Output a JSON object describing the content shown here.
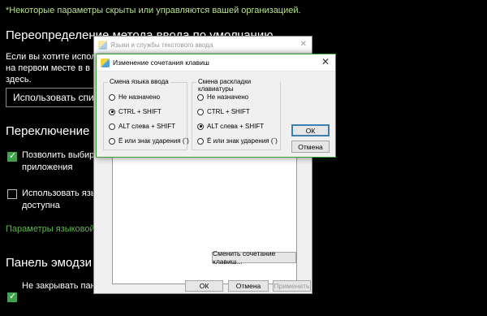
{
  "settings": {
    "notice": "*Некоторые параметры скрыты или управляются вашей организацией.",
    "section1_title": "Переопределение метода ввода по умолчанию",
    "section1_desc_line1": "Если вы хотите использ",
    "section1_desc_line2": "на первом месте в в",
    "section1_desc_line3": "здесь.",
    "use_list_button": "Использовать список",
    "section2_title": "Переключение ме",
    "checkbox1_label_line1": "Позволить выбира",
    "checkbox1_label_line2": "приложения",
    "checkbox1_checked": true,
    "checkbox2_label_line1": "Использовать язык",
    "checkbox2_label_line2": "доступна",
    "checkbox2_checked": false,
    "lang_params_link": "Параметры языковой п",
    "section3_title": "Панель эмодзи",
    "checkbox3_label": "Не закрывать панел",
    "checkbox3_checked": true
  },
  "dialog_languages": {
    "title": "Языки и службы текстового ввода",
    "change_keys_button": "Сменить сочетание клавиш...",
    "ok_button": "ОК",
    "cancel_button": "Отмена",
    "apply_button": "Применить"
  },
  "dialog_hotkeys": {
    "title": "Изменение сочетания клавиш",
    "group_input_language": {
      "title": "Смена языка ввода",
      "options": [
        "Не назначено",
        "CTRL + SHIFT",
        "ALT слева + SHIFT",
        "Ё или знак ударения (`)"
      ],
      "selected": 1
    },
    "group_keyboard_layout": {
      "title": "Смена раскладки клавиатуры",
      "options": [
        "Не назначено",
        "CTRL + SHIFT",
        "ALT слева + SHIFT",
        "Ё или знак ударения (`)"
      ],
      "selected": 2
    },
    "ok_button": "ОК",
    "cancel_button": "Отмена"
  }
}
